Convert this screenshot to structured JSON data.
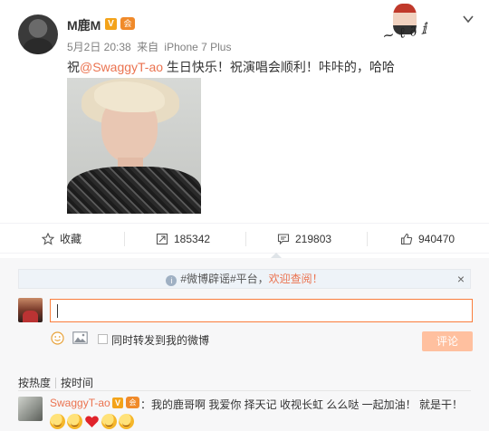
{
  "post": {
    "username": "M鹿M",
    "v_badge": "V",
    "member_badge": "会",
    "date": "5月2日 20:38",
    "via": "来自",
    "device": "iPhone 7 Plus",
    "content_prefix": "祝",
    "mention": "@SwaggyT-ao",
    "content_suffix": " 生日快乐！祝演唱会顺利！咔咔的，哈哈",
    "icons": {
      "menu": "chevron-down-icon",
      "logo": "signature-figure-logo"
    }
  },
  "actions": [
    {
      "label": "收藏",
      "icon": "star-icon"
    },
    {
      "label": "185342",
      "icon": "repost-icon"
    },
    {
      "label": "219803",
      "icon": "comment-icon"
    },
    {
      "label": "940470",
      "icon": "thumbs-up-icon"
    }
  ],
  "notice": {
    "prefix": "#微博辟谣#平台，",
    "highlight": "欢迎查阅！",
    "close": "×",
    "info": "i"
  },
  "composer": {
    "repost_label": "同时转发到我的微博",
    "submit_label": "评论",
    "input_value": ""
  },
  "sort": {
    "hot": "按热度",
    "time": "按时间"
  },
  "comments": [
    {
      "username": "SwaggyT-ao",
      "v_badge": "V",
      "member_badge": "会",
      "text": "：我的鹿哥啊 我爱你  择天记 收视长虹 么么哒  一起加油！ 就是干！"
    }
  ],
  "colors": {
    "accent": "#eb7350",
    "submit_bg": "#ffc09f",
    "input_border": "#fa7d3c",
    "badge": "#f3a31a"
  }
}
